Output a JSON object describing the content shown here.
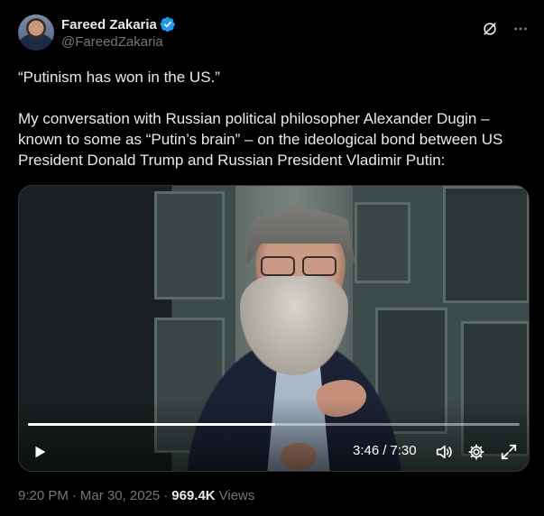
{
  "author": {
    "display_name": "Fareed Zakaria",
    "handle": "@FareedZakaria",
    "verified_color": "#1d9bf0"
  },
  "header_actions": {
    "grok_icon": "grok-icon",
    "more_icon": "more-icon"
  },
  "post": {
    "paragraph_1": "“Putinism has won in the US.”",
    "paragraph_2": "My conversation with Russian political philosopher Alexander Dugin – known to some as “Putin’s brain” – on the ideological bond between US President Donald Trump and Russian President Vladimir Putin:"
  },
  "video": {
    "current_time": "3:46",
    "separator": "/",
    "duration": "7:30",
    "progress_fraction": 0.502
  },
  "meta": {
    "time": "9:20 PM",
    "separator": "·",
    "date": "Mar 30, 2025",
    "views_count": "969.4K",
    "views_label": "Views"
  }
}
